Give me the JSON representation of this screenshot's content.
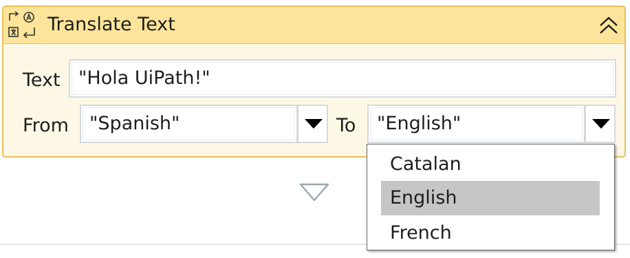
{
  "activity": {
    "title": "Translate Text",
    "icon": "translate-icon",
    "collapse_icon": "double-chevron-up-icon",
    "accent_colors": {
      "header": "#fce59a",
      "body": "#fdf8e6",
      "border": "#e6c15a"
    }
  },
  "fields": {
    "text": {
      "label": "Text",
      "value": "\"Hola UiPath!\""
    },
    "from": {
      "label": "From",
      "value": "\"Spanish\""
    },
    "to": {
      "label": "To",
      "value": "\"English\""
    }
  },
  "dropdown": {
    "options": [
      {
        "label": "Catalan",
        "selected": false
      },
      {
        "label": "English",
        "selected": true
      },
      {
        "label": "French",
        "selected": false
      }
    ]
  }
}
